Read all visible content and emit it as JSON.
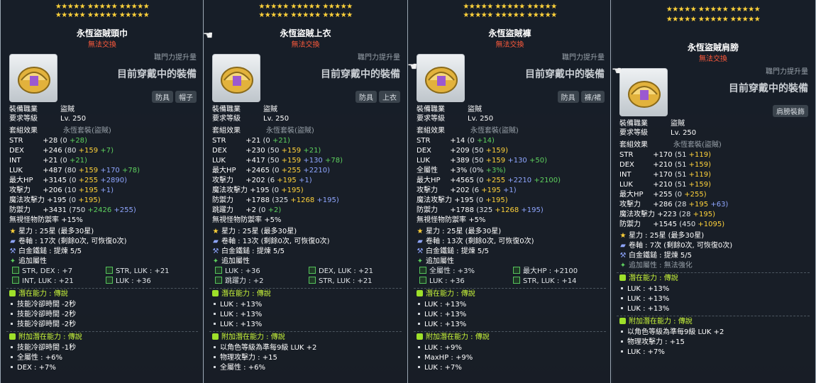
{
  "stars_row": "★★★★★ ★★★★★ ★★★★★",
  "common": {
    "bonus_label": "職門力提升量",
    "equipped_label": "目前穿戴中的裝備",
    "trade": "無法交換",
    "job_label": "裝備職業",
    "job_value": "盜賊",
    "level_label": "要求等級",
    "level_value": "Lv. 250",
    "set_label": "套組效果",
    "set_value": "永恆套裝(盜賊)",
    "starforce_label": "星力 :",
    "starforce_value": "25星 (最多30星)",
    "scroll_label": "卷軸 :",
    "hammer_label": "白金鐵鎚 : 提煉 5/5",
    "flame_label": "追加屬性",
    "potential_label": "潛在能力 : 傳說",
    "add_potential_label": "附加潛在能力 : 傳說"
  },
  "panels": [
    {
      "title": "永恆盜賊頭巾",
      "tags": [
        "防具",
        "帽子"
      ],
      "stats": [
        {
          "n": "STR",
          "v": "+28",
          "p": [
            "(0",
            "+28)"
          ],
          "c": [
            "sg",
            "gr"
          ]
        },
        {
          "n": "DEX",
          "v": "+246",
          "p": [
            "(80",
            "+159",
            "+7)"
          ],
          "c": [
            "sg",
            "ye",
            "gr"
          ]
        },
        {
          "n": "INT",
          "v": "+21",
          "p": [
            "(0",
            "+21)"
          ],
          "c": [
            "sg",
            "gr"
          ]
        },
        {
          "n": "LUK",
          "v": "+487",
          "p": [
            "(80",
            "+159",
            "+170",
            "+78)"
          ],
          "c": [
            "sg",
            "ye",
            "bl",
            "gr"
          ]
        },
        {
          "n": "最大HP",
          "v": "+3145",
          "p": [
            "(0",
            "+255",
            "+2890)"
          ],
          "c": [
            "sg",
            "ye",
            "bl"
          ]
        },
        {
          "n": "攻擊力",
          "v": "+206",
          "p": [
            "(10",
            "+195",
            "+1)"
          ],
          "c": [
            "sg",
            "ye",
            "bl"
          ]
        },
        {
          "n": "魔法攻擊力",
          "v": "+195",
          "p": [
            "(0",
            "+195)"
          ],
          "c": [
            "sg",
            "ye"
          ]
        },
        {
          "n": "防禦力",
          "v": "+3431",
          "p": [
            "(750",
            "+2426",
            "+255)"
          ],
          "c": [
            "sg",
            "gr",
            "bl"
          ]
        },
        {
          "n": "無視怪物防禦率",
          "v": "+15%",
          "p": [],
          "c": []
        }
      ],
      "scroll_value": "17次 (剩餘0次, 可恢復0次)",
      "flame": [
        "STR, DEX : +7",
        "STR, LUK : +21",
        "INT, LUK : +21",
        "LUK : +36"
      ],
      "potential": [
        "技能冷卻時間 -2秒",
        "技能冷卻時間 -2秒",
        "技能冷卻時間 -2秒"
      ],
      "add_potential": [
        "技能冷卻時間 -1秒",
        "全屬性 : +6%",
        "DEX : +7%"
      ]
    },
    {
      "title": "永恆盜賊上衣",
      "tags": [
        "防具",
        "上衣"
      ],
      "stats": [
        {
          "n": "STR",
          "v": "+21",
          "p": [
            "(0",
            "+21)"
          ],
          "c": [
            "sg",
            "gr"
          ]
        },
        {
          "n": "DEX",
          "v": "+230",
          "p": [
            "(50",
            "+159",
            "+21)"
          ],
          "c": [
            "sg",
            "ye",
            "gr"
          ]
        },
        {
          "n": "LUK",
          "v": "+417",
          "p": [
            "(50",
            "+159",
            "+130",
            "+78)"
          ],
          "c": [
            "sg",
            "ye",
            "bl",
            "gr"
          ]
        },
        {
          "n": "最大HP",
          "v": "+2465",
          "p": [
            "(0",
            "+255",
            "+2210)"
          ],
          "c": [
            "sg",
            "ye",
            "bl"
          ]
        },
        {
          "n": "攻擊力",
          "v": "+202",
          "p": [
            "(6",
            "+195",
            "+1)"
          ],
          "c": [
            "sg",
            "ye",
            "bl"
          ]
        },
        {
          "n": "魔法攻擊力",
          "v": "+195",
          "p": [
            "(0",
            "+195)"
          ],
          "c": [
            "sg",
            "ye"
          ]
        },
        {
          "n": "防禦力",
          "v": "+1788",
          "p": [
            "(325",
            "+1268",
            "+195)"
          ],
          "c": [
            "sg",
            "ye",
            "bl"
          ]
        },
        {
          "n": "跳躍力",
          "v": "+2",
          "p": [
            "(0",
            "+2)"
          ],
          "c": [
            "sg",
            "gr"
          ]
        },
        {
          "n": "無視怪物防禦率",
          "v": "+5%",
          "p": [],
          "c": []
        }
      ],
      "scroll_value": "13次 (剩餘0次, 可恢復0次)",
      "flame": [
        "LUK : +36",
        "DEX, LUK : +21",
        "跳躍力 : +2",
        "STR, LUK : +21"
      ],
      "potential": [
        "LUK : +13%",
        "LUK : +13%",
        "LUK : +13%"
      ],
      "add_potential": [
        "以角色等級為準每9級 LUK +2",
        "物理攻擊力 : +15",
        "全屬性 : +6%"
      ]
    },
    {
      "title": "永恆盜賊褲",
      "tags": [
        "防具",
        "褲/裙"
      ],
      "stats": [
        {
          "n": "STR",
          "v": "+14",
          "p": [
            "(0",
            "+14)"
          ],
          "c": [
            "sg",
            "gr"
          ]
        },
        {
          "n": "DEX",
          "v": "+209",
          "p": [
            "(50",
            "+159)"
          ],
          "c": [
            "sg",
            "ye"
          ]
        },
        {
          "n": "LUK",
          "v": "+389",
          "p": [
            "(50",
            "+159",
            "+130",
            "+50)"
          ],
          "c": [
            "sg",
            "ye",
            "bl",
            "gr"
          ]
        },
        {
          "n": "全屬性",
          "v": "+3%",
          "p": [
            "(0%",
            "+3%)"
          ],
          "c": [
            "sg",
            "gr"
          ]
        },
        {
          "n": "最大HP",
          "v": "+4565",
          "p": [
            "(0",
            "+255",
            "+2210",
            "+2100)"
          ],
          "c": [
            "sg",
            "ye",
            "bl",
            "gr"
          ]
        },
        {
          "n": "攻擊力",
          "v": "+202",
          "p": [
            "(6",
            "+195",
            "+1)"
          ],
          "c": [
            "sg",
            "ye",
            "bl"
          ]
        },
        {
          "n": "魔法攻擊力",
          "v": "+195",
          "p": [
            "(0",
            "+195)"
          ],
          "c": [
            "sg",
            "ye"
          ]
        },
        {
          "n": "防禦力",
          "v": "+1788",
          "p": [
            "(325",
            "+1268",
            "+195)"
          ],
          "c": [
            "sg",
            "ye",
            "bl"
          ]
        },
        {
          "n": "無視怪物防禦率",
          "v": "+5%",
          "p": [],
          "c": []
        }
      ],
      "scroll_value": "13次 (剩餘0次, 可恢復0次)",
      "flame": [
        "全屬性 : +3%",
        "最大HP : +2100",
        "LUK : +36",
        "STR, LUK : +14"
      ],
      "potential": [
        "LUK : +13%",
        "LUK : +13%",
        "LUK : +13%"
      ],
      "add_potential": [
        "LUK : +9%",
        "MaxHP : +9%",
        "LUK : +7%"
      ]
    },
    {
      "title": "永恆盜賊肩膀",
      "tags": [
        "肩膀裝飾"
      ],
      "stats": [
        {
          "n": "STR",
          "v": "+170",
          "p": [
            "(51",
            "+119)"
          ],
          "c": [
            "sg",
            "ye"
          ]
        },
        {
          "n": "DEX",
          "v": "+210",
          "p": [
            "(51",
            "+159)"
          ],
          "c": [
            "sg",
            "ye"
          ]
        },
        {
          "n": "INT",
          "v": "+170",
          "p": [
            "(51",
            "+119)"
          ],
          "c": [
            "sg",
            "ye"
          ]
        },
        {
          "n": "LUK",
          "v": "+210",
          "p": [
            "(51",
            "+159)"
          ],
          "c": [
            "sg",
            "ye"
          ]
        },
        {
          "n": "最大HP",
          "v": "+255",
          "p": [
            "(0",
            "+255)"
          ],
          "c": [
            "sg",
            "ye"
          ]
        },
        {
          "n": "攻擊力",
          "v": "+286",
          "p": [
            "(28",
            "+195",
            "+63)"
          ],
          "c": [
            "sg",
            "ye",
            "bl"
          ]
        },
        {
          "n": "魔法攻擊力",
          "v": "+223",
          "p": [
            "(28",
            "+195)"
          ],
          "c": [
            "sg",
            "ye"
          ]
        },
        {
          "n": "防禦力",
          "v": "+1545",
          "p": [
            "(450",
            "+1095)"
          ],
          "c": [
            "sg",
            "ye"
          ]
        }
      ],
      "scroll_value": "7次 (剩餘0次, 可恢復0次)",
      "hammer_label": "白金鐵鎚 : 提煉 5/5",
      "flame_label": "追加屬性 : 無法強化",
      "flame": [],
      "potential": [
        "LUK : +13%",
        "LUK : +13%",
        "LUK : +13%"
      ],
      "add_potential": [
        "以角色等級為準每9級 LUK +2",
        "物理攻擊力 : +15",
        "LUK : +7%"
      ]
    }
  ]
}
